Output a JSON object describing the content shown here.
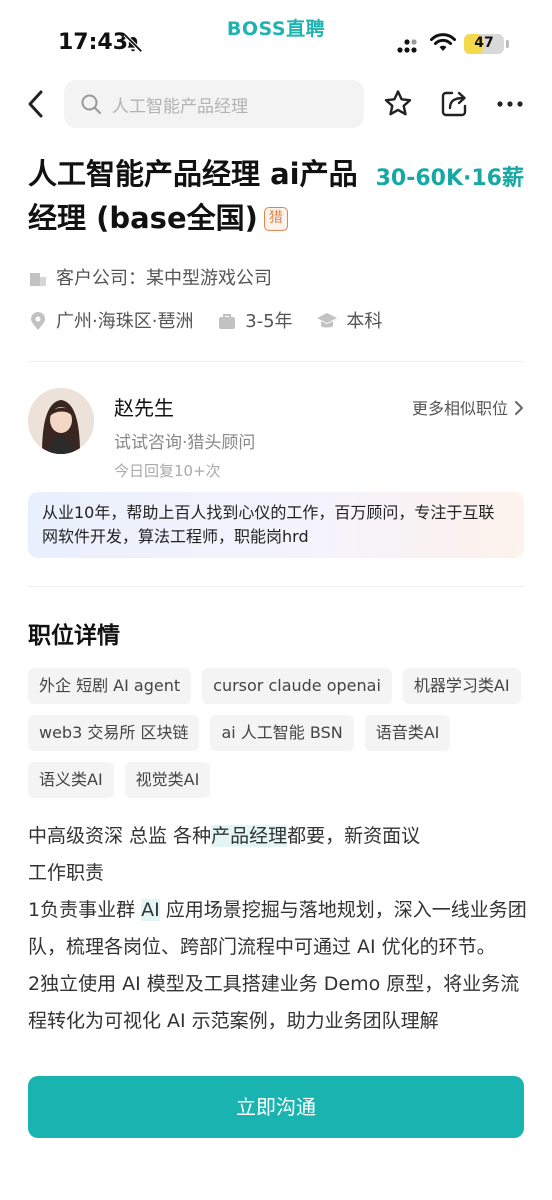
{
  "status_bar": {
    "time": "17:43",
    "app_name": "BOSS直聘",
    "battery": "47",
    "battery_level": 0.47
  },
  "search": {
    "placeholder": "人工智能产品经理"
  },
  "job": {
    "title": "人工智能产品经理 ai产品经理 (base全国)",
    "tag": "猎",
    "salary": "30-60K·16薪",
    "client_label": "客户公司：",
    "client": "某中型游戏公司",
    "location": "广州·海珠区·琶洲",
    "experience": "3-5年",
    "education": "本科"
  },
  "recruiter": {
    "name": "赵先生",
    "role": "试试咨询·猎头顾问",
    "reply": "今日回复10+次",
    "more_link": "更多相似职位",
    "intro": "从业10年，帮助上百人找到心仪的工作，百万顾问，专注于互联网软件开发，算法工程师，职能岗hrd"
  },
  "details": {
    "section_title": "职位详情",
    "tags": [
      "外企 短剧 AI agent",
      "cursor claude openai",
      "机器学习类AI",
      "web3  交易所  区块链",
      "ai 人工智能 BSN",
      "语音类AI",
      "语义类AI",
      "视觉类AI"
    ],
    "line1_pre": "中高级资深 总监 各种",
    "line1_hl": "产品经理",
    "line1_post": "都要，新资面议",
    "line2": "工作职责",
    "line3_pre": "1负责事业群 ",
    "line3_hl": "AI",
    "line3_post": " 应用场景挖掘与落地规划，深入一线业务团队，梳理各岗位、跨部门流程中可通过 AI 优化的环节。",
    "line4": "2独立使用 AI 模型及工具搭建业务 Demo 原型，将业务流程转化为可视化 AI 示范案例，助力业务团队理解"
  },
  "cta": {
    "label": "立即沟通"
  },
  "colors": {
    "brand": "#1ab4b0",
    "salary": "#18a8a4",
    "hunter_tag": "#e0854b"
  }
}
